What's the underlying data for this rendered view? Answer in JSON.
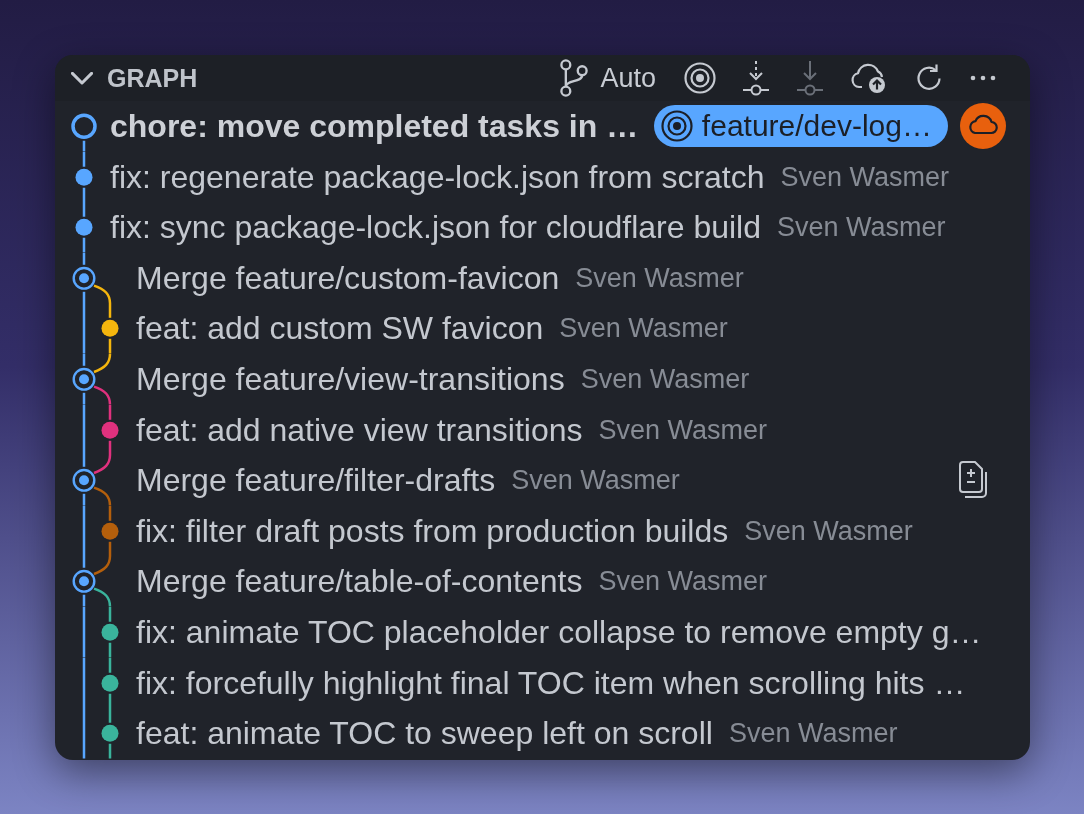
{
  "panel": {
    "title": "GRAPH",
    "expanded": true,
    "branch_filter": "Auto",
    "actions": [
      {
        "kind": "target",
        "disabled": false
      },
      {
        "kind": "fetch",
        "disabled": false
      },
      {
        "kind": "pull",
        "disabled": true
      },
      {
        "kind": "publish",
        "disabled": false
      },
      {
        "kind": "refresh",
        "disabled": false
      },
      {
        "kind": "more",
        "disabled": false
      }
    ]
  },
  "commits": [
    {
      "kind": "head",
      "message": "chore: move completed tasks in …",
      "hovered": false,
      "branch": {
        "label": "feature/dev-log…",
        "remote": true
      }
    },
    {
      "kind": "commit",
      "message": "fix: regenerate package-lock.json from scratch",
      "author": "Sven Wasmer",
      "hovered": false
    },
    {
      "kind": "commit",
      "message": "fix: sync package-lock.json for cloudflare build",
      "author": "Sven Wasmer",
      "hovered": false
    },
    {
      "kind": "merge",
      "message": "Merge feature/custom-favicon",
      "author": "Sven Wasmer",
      "hovered": false,
      "children": [
        {
          "kind": "commit",
          "message": "feat: add custom SW favicon",
          "author": "Sven Wasmer",
          "hovered": false,
          "color": "#f5b60d"
        }
      ]
    },
    {
      "kind": "merge",
      "message": "Merge feature/view-transitions",
      "author": "Sven Wasmer",
      "hovered": false,
      "children": [
        {
          "kind": "commit",
          "message": "feat: add native view transitions",
          "author": "Sven Wasmer",
          "hovered": false,
          "color": "#e0317e"
        }
      ]
    },
    {
      "kind": "merge",
      "message": "Merge feature/filter-drafts",
      "author": "Sven Wasmer",
      "hovered": true,
      "children": [
        {
          "kind": "commit",
          "message": "fix: filter draft posts from production builds",
          "author": "Sven Wasmer",
          "hovered": false,
          "color": "#b45f0c"
        }
      ]
    },
    {
      "kind": "merge",
      "message": "Merge feature/table-of-contents",
      "author": "Sven Wasmer",
      "hovered": false,
      "children": [
        {
          "kind": "commit",
          "message": "fix: animate TOC placeholder collapse to remove empty g…",
          "hovered": false,
          "color": "#3ab49c"
        },
        {
          "kind": "commit",
          "message": "fix: forcefully highlight final TOC item when scrolling hits …",
          "hovered": false,
          "color": "#3ab49c"
        },
        {
          "kind": "commit",
          "message": "feat: animate TOC to sweep left on scroll",
          "author": "Sven Wasmer",
          "hovered": false,
          "color": "#3ab49c"
        }
      ]
    }
  ]
}
